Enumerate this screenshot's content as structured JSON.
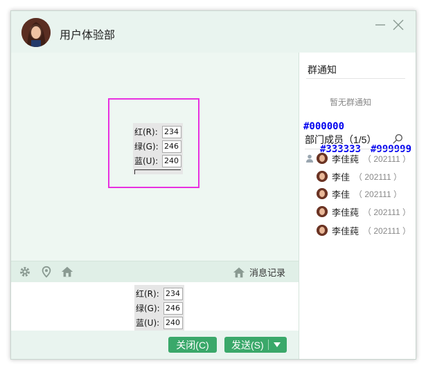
{
  "window": {
    "title": "用户体验部"
  },
  "preview": {
    "rows": [
      {
        "label": "红(R):",
        "value": "234"
      },
      {
        "label": "绿(G):",
        "value": "246"
      },
      {
        "label": "蓝(U):",
        "value": "240"
      }
    ]
  },
  "toolbar": {
    "icons": [
      "gear-icon",
      "location-pin-icon",
      "home-icon"
    ],
    "history_label": "消息记录"
  },
  "input_panel": {
    "rows": [
      {
        "label": "红(R):",
        "value": "234"
      },
      {
        "label": "绿(G):",
        "value": "246"
      },
      {
        "label": "蓝(U):",
        "value": "240"
      }
    ]
  },
  "actions": {
    "close_label": "关闭(C)",
    "send_label": "发送(S)"
  },
  "sidebar": {
    "notice_title": "群通知",
    "notice_empty": "暂无群通知",
    "color_tags": [
      "#000000",
      "#333333",
      "#999999"
    ],
    "members_title": "部门成员（1/5）",
    "members": [
      {
        "name": "李佳莼",
        "id": "（ 202111 ）"
      },
      {
        "name": "李佳",
        "id": "（ 202111 ）"
      },
      {
        "name": "李佳",
        "id": "（ 202111 ）"
      },
      {
        "name": "李佳莼",
        "id": "（ 202111 ）"
      },
      {
        "name": "李佳莼",
        "id": "（ 202111 ）"
      }
    ]
  },
  "colors": {
    "accent": "#3aa86a",
    "highlight_box": "#e830e0",
    "window_bg": "#eef7f2",
    "annotation": "#0000ee"
  }
}
